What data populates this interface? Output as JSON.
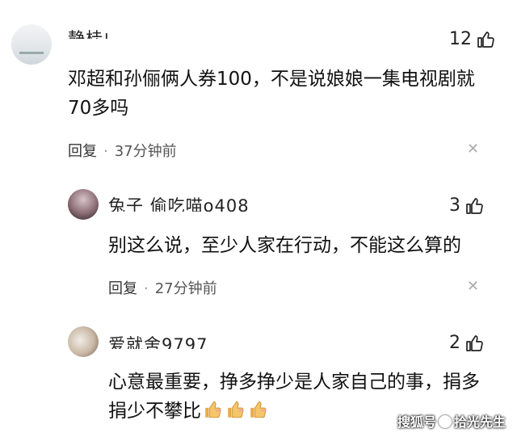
{
  "comments": [
    {
      "username": "静桂∟",
      "likes": "12",
      "text": "邓超和孙俪俩人券100，不是说娘娘一集电视剧就70多吗",
      "reply_label": "回复",
      "time": "37分钟前"
    },
    {
      "username": "兔子 偷吃喵o408",
      "likes": "3",
      "text": "别这么说，至少人家在行动，不能这么算的",
      "reply_label": "回复",
      "time": "27分钟前"
    },
    {
      "username": "爱就舍9797",
      "likes": "2",
      "text": "心意最重要，挣多挣少是人家自己的事，捐多捐少不攀比",
      "reply_label": "",
      "time": ""
    }
  ],
  "separator": "·",
  "close_glyph": "✕",
  "emoji": [
    "thumbs-up-icon",
    "thumbs-up-icon",
    "thumbs-up-icon"
  ],
  "watermark": {
    "left": "搜狐号",
    "right": "拾光先生"
  }
}
